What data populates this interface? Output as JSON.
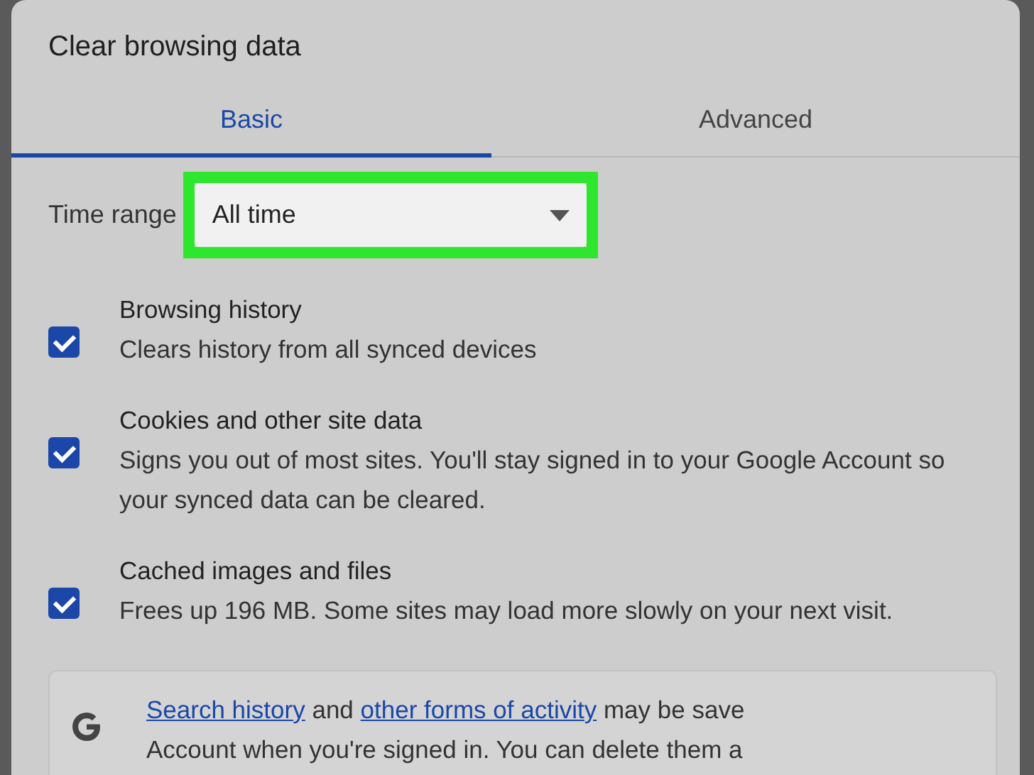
{
  "dialog": {
    "title": "Clear browsing data"
  },
  "tabs": [
    {
      "label": "Basic",
      "selected": true
    },
    {
      "label": "Advanced",
      "selected": false
    }
  ],
  "time_range": {
    "label": "Time range",
    "value": "All time",
    "highlighted": true
  },
  "options": [
    {
      "title": "Browsing history",
      "description": "Clears history from all synced devices",
      "checked": true
    },
    {
      "title": "Cookies and other site data",
      "description": "Signs you out of most sites. You'll stay signed in to your Google Account so your synced data can be cleared.",
      "checked": true
    },
    {
      "title": "Cached images and files",
      "description": "Frees up 196 MB. Some sites may load more slowly on your next visit.",
      "checked": true
    }
  ],
  "info": {
    "lines": [
      [
        {
          "kind": "link",
          "text": "Search history"
        },
        {
          "kind": "text",
          "text": " and "
        },
        {
          "kind": "link",
          "text": "other forms of activity"
        },
        {
          "kind": "text",
          "text": " may be save"
        }
      ],
      [
        {
          "kind": "text",
          "text": "Account when you're signed in. You can delete them a"
        }
      ]
    ]
  }
}
